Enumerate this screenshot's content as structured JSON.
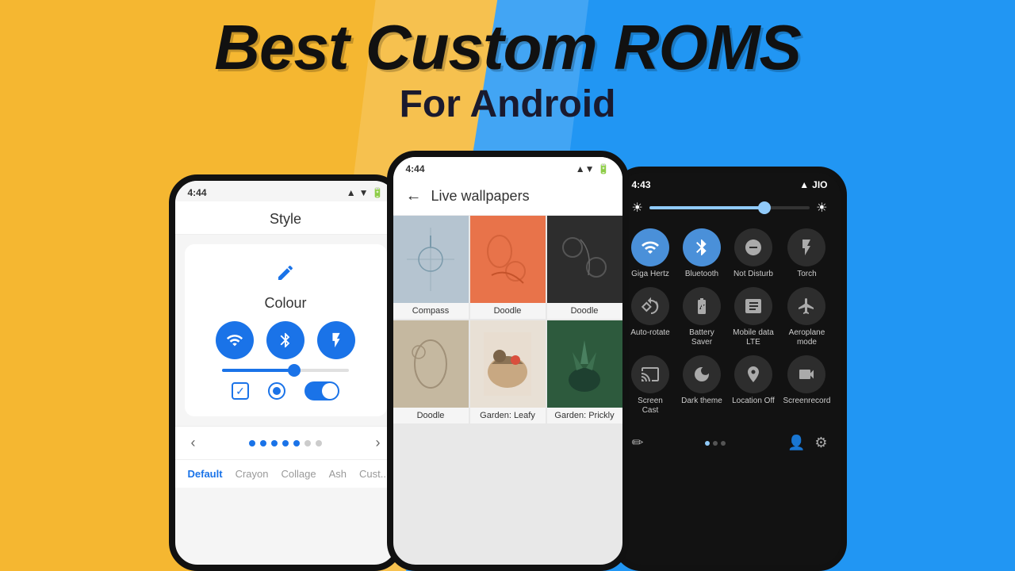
{
  "title": {
    "main": "Best Custom ROMS",
    "sub": "For Android"
  },
  "phone_left": {
    "status_time": "4:44",
    "screen_title": "Style",
    "section_label": "Colour",
    "icons": [
      "wifi",
      "bluetooth",
      "flash"
    ],
    "nav_tabs": [
      "Default",
      "Crayon",
      "Collage",
      "Ash",
      "Cust..."
    ]
  },
  "phone_center": {
    "status_time": "4:44",
    "screen_title": "Live wallpapers",
    "wallpapers": [
      {
        "name": "Compass",
        "color": "#b5c4d0"
      },
      {
        "name": "Doodle",
        "color": "#e8734a"
      },
      {
        "name": "Doodle",
        "color": "#2d2d2d"
      },
      {
        "name": "Doodle",
        "color": "#c5b8a0"
      },
      {
        "name": "Garden: Leafy",
        "color": "#e8e0d5"
      },
      {
        "name": "Garden: Prickly",
        "color": "#2d5a3d"
      }
    ]
  },
  "phone_right": {
    "status_time": "4:43",
    "carrier": "JIO",
    "tiles": [
      {
        "label": "Giga Hertz",
        "icon": "wifi",
        "active": true
      },
      {
        "label": "Bluetooth",
        "icon": "bluetooth",
        "active": true
      },
      {
        "label": "Not Disturb",
        "icon": "minus-circle",
        "active": false
      },
      {
        "label": "Torch",
        "icon": "flash",
        "active": false
      },
      {
        "label": "Auto-rotate",
        "icon": "rotate",
        "active": false
      },
      {
        "label": "Battery Saver",
        "icon": "battery",
        "active": false
      },
      {
        "label": "Mobile data LTE",
        "icon": "data",
        "active": false
      },
      {
        "label": "Aeroplane mode",
        "icon": "plane",
        "active": false
      },
      {
        "label": "Screen Cast",
        "icon": "cast",
        "active": false
      },
      {
        "label": "Dark theme",
        "icon": "moon",
        "active": false
      },
      {
        "label": "Location Off",
        "icon": "location",
        "active": false
      },
      {
        "label": "Screenrecord",
        "icon": "record",
        "active": false
      }
    ]
  }
}
